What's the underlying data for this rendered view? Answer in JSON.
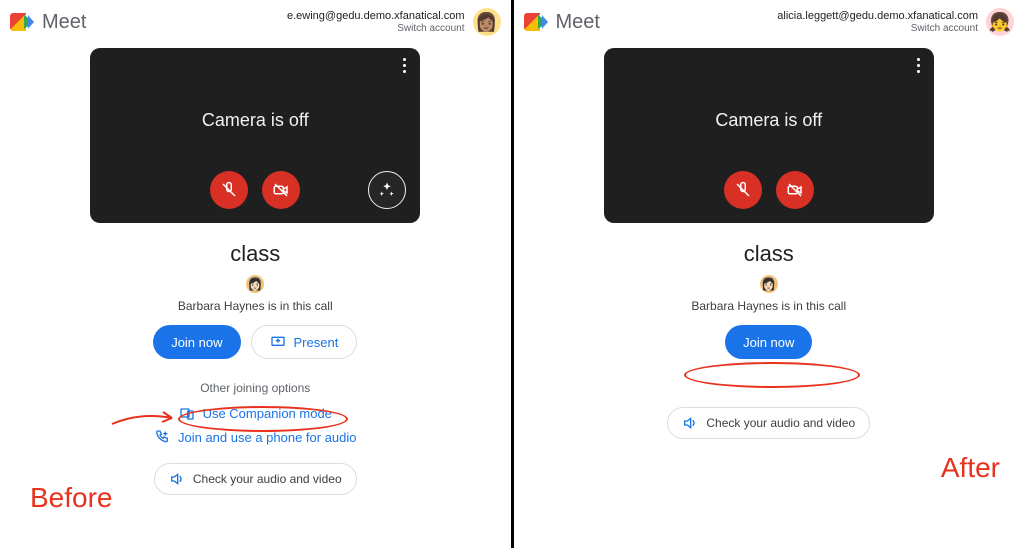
{
  "brand": "Meet",
  "left": {
    "account_email": "e.ewing@gedu.demo.xfanatical.com",
    "switch_label": "Switch account",
    "camera_off": "Camera is off",
    "meeting_name": "class",
    "in_call_text": "Barbara Haynes is in this call",
    "join_label": "Join now",
    "present_label": "Present",
    "other_options_label": "Other joining options",
    "options": [
      {
        "label": "Use Companion mode",
        "icon": "companion"
      },
      {
        "label": "Join and use a phone for audio",
        "icon": "phone"
      }
    ],
    "check_av_label": "Check your audio and video",
    "annotation_label": "Before"
  },
  "right": {
    "account_email": "alicia.leggett@gedu.demo.xfanatical.com",
    "switch_label": "Switch account",
    "camera_off": "Camera is off",
    "meeting_name": "class",
    "in_call_text": "Barbara Haynes is in this call",
    "join_label": "Join now",
    "check_av_label": "Check your audio and video",
    "annotation_label": "After"
  }
}
